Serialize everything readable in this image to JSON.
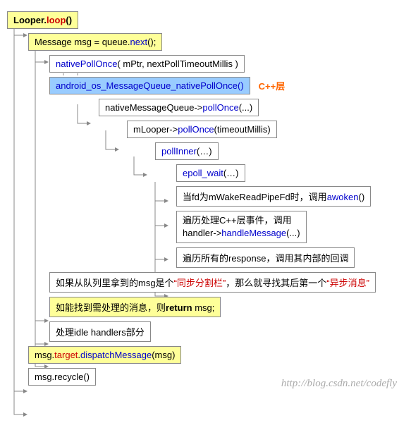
{
  "header": {
    "looper": "Looper.",
    "loop": "loop",
    "paren": "()"
  },
  "queue_next": {
    "prefix": "Message msg = queue.",
    "call": "next",
    "suffix": "();"
  },
  "native_poll_once": {
    "name": "nativePollOnce",
    "args": "( mPtr, nextPollTimeoutMillis )"
  },
  "android_jni": {
    "text": "android_os_MessageQueue_nativePollOnce()"
  },
  "cpp_layer": "C++层",
  "native_mq": {
    "prefix": "nativeMessageQueue->",
    "call": "pollOnce",
    "suffix": "(...)"
  },
  "mlooper": {
    "prefix": "mLooper->",
    "call": "pollOnce",
    "suffix": "(timeoutMillis)"
  },
  "poll_inner": {
    "call": "pollInner",
    "suffix": "(…)"
  },
  "epoll": {
    "call": "epoll_wait",
    "suffix": "(…)"
  },
  "awoken": {
    "prefix": "当fd为mWakeReadPipeFd时，调用",
    "call": "awoken",
    "suffix": "()"
  },
  "handler_msg": {
    "line1": "遍历处理C++层事件，调用",
    "prefix": "handler->",
    "call": "handleMessage",
    "suffix": "(...)"
  },
  "response": "遍历所有的response，调用其内部的回调",
  "sync_barrier": {
    "prefix": "如果从队列里拿到的msg是个",
    "quote1": "“同步分割栏”",
    "mid": "，那么就寻找其后第一个",
    "quote2": "“异步消息”"
  },
  "return_msg": {
    "prefix": "如能找到需处理的消息，则",
    "ret": "return",
    "suffix": " msg;"
  },
  "idle": "处理idle handlers部分",
  "dispatch": {
    "prefix": "msg.",
    "target": "target",
    "dot": ".",
    "call": "dispatchMessage",
    "suffix": "(msg)"
  },
  "recycle": "msg.recycle()",
  "watermark": "http://blog.csdn.net/codefly"
}
